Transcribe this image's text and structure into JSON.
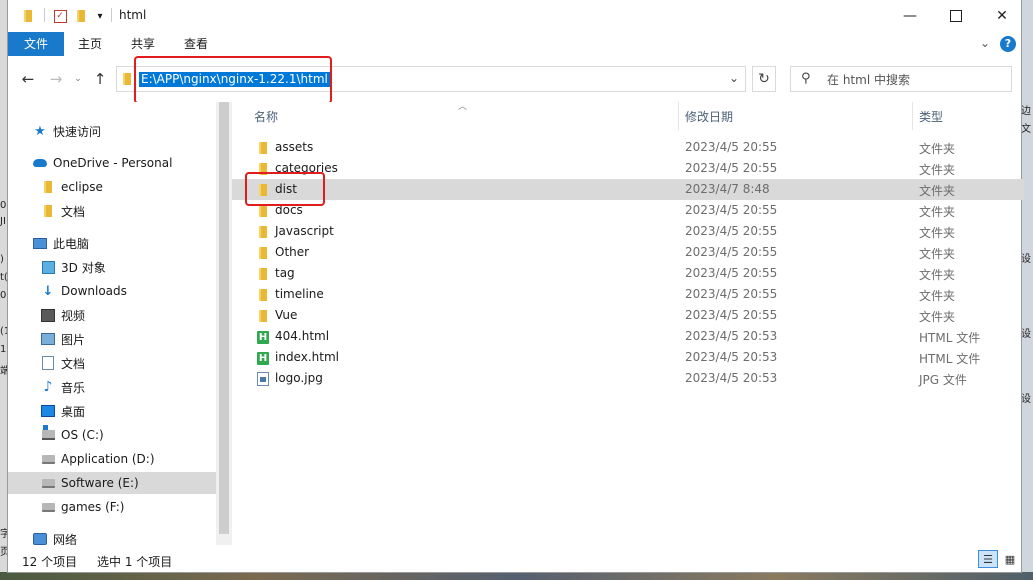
{
  "window": {
    "title": "html"
  },
  "background": {
    "left_fragments": [
      "0",
      "JI",
      ")",
      "t(",
      "0",
      "(1",
      "1)",
      "端",
      "字",
      "页"
    ],
    "right_fragments": [
      "边",
      "文",
      "设",
      "设",
      "设"
    ]
  },
  "ribbon": {
    "tabs": [
      "文件",
      "主页",
      "共享",
      "查看"
    ]
  },
  "address": {
    "path": "E:\\APP\\nginx\\nginx-1.22.1\\html"
  },
  "search": {
    "placeholder": "在 html 中搜索"
  },
  "sidebar": {
    "items": [
      {
        "label": "快速访问",
        "icon": "star-icon"
      },
      {
        "label": "OneDrive - Personal",
        "icon": "cloud-icon"
      },
      {
        "label": "eclipse",
        "icon": "folder-icon"
      },
      {
        "label": "文档",
        "icon": "folder-icon"
      },
      {
        "label": "此电脑",
        "icon": "computer-icon"
      },
      {
        "label": "3D 对象",
        "icon": "3d-objects-icon"
      },
      {
        "label": "Downloads",
        "icon": "download-icon"
      },
      {
        "label": "视频",
        "icon": "video-icon"
      },
      {
        "label": "图片",
        "icon": "pictures-icon"
      },
      {
        "label": "文档",
        "icon": "documents-icon"
      },
      {
        "label": "音乐",
        "icon": "music-icon"
      },
      {
        "label": "桌面",
        "icon": "desktop-icon"
      },
      {
        "label": "OS (C:)",
        "icon": "system-drive-icon"
      },
      {
        "label": "Application (D:)",
        "icon": "drive-icon"
      },
      {
        "label": "Software (E:)",
        "icon": "drive-icon"
      },
      {
        "label": "games (F:)",
        "icon": "drive-icon"
      },
      {
        "label": "网络",
        "icon": "network-icon"
      }
    ]
  },
  "list": {
    "columns": {
      "name": "名称",
      "date": "修改日期",
      "type": "类型"
    },
    "rows": [
      {
        "name": "assets",
        "date": "2023/4/5 20:55",
        "type": "文件夹",
        "icon": "folder-icon"
      },
      {
        "name": "categories",
        "date": "2023/4/5 20:55",
        "type": "文件夹",
        "icon": "folder-icon"
      },
      {
        "name": "dist",
        "date": "2023/4/7 8:48",
        "type": "文件夹",
        "icon": "folder-icon"
      },
      {
        "name": "docs",
        "date": "2023/4/5 20:55",
        "type": "文件夹",
        "icon": "folder-icon"
      },
      {
        "name": "Javascript",
        "date": "2023/4/5 20:55",
        "type": "文件夹",
        "icon": "folder-icon"
      },
      {
        "name": "Other",
        "date": "2023/4/5 20:55",
        "type": "文件夹",
        "icon": "folder-icon"
      },
      {
        "name": "tag",
        "date": "2023/4/5 20:55",
        "type": "文件夹",
        "icon": "folder-icon"
      },
      {
        "name": "timeline",
        "date": "2023/4/5 20:55",
        "type": "文件夹",
        "icon": "folder-icon"
      },
      {
        "name": "Vue",
        "date": "2023/4/5 20:55",
        "type": "文件夹",
        "icon": "folder-icon"
      },
      {
        "name": "404.html",
        "date": "2023/4/5 20:53",
        "type": "HTML 文件",
        "icon": "html-file-icon"
      },
      {
        "name": "index.html",
        "date": "2023/4/5 20:53",
        "type": "HTML 文件",
        "icon": "html-file-icon"
      },
      {
        "name": "logo.jpg",
        "date": "2023/4/5 20:53",
        "type": "JPG 文件",
        "icon": "image-file-icon"
      }
    ]
  },
  "status": {
    "count": "12 个项目",
    "selected": "选中 1 个项目"
  },
  "colors": {
    "accent": "#1979ca",
    "selection": "#d9d9d9",
    "address_highlight": "#0078d7",
    "annotation": "#e11c1c"
  }
}
